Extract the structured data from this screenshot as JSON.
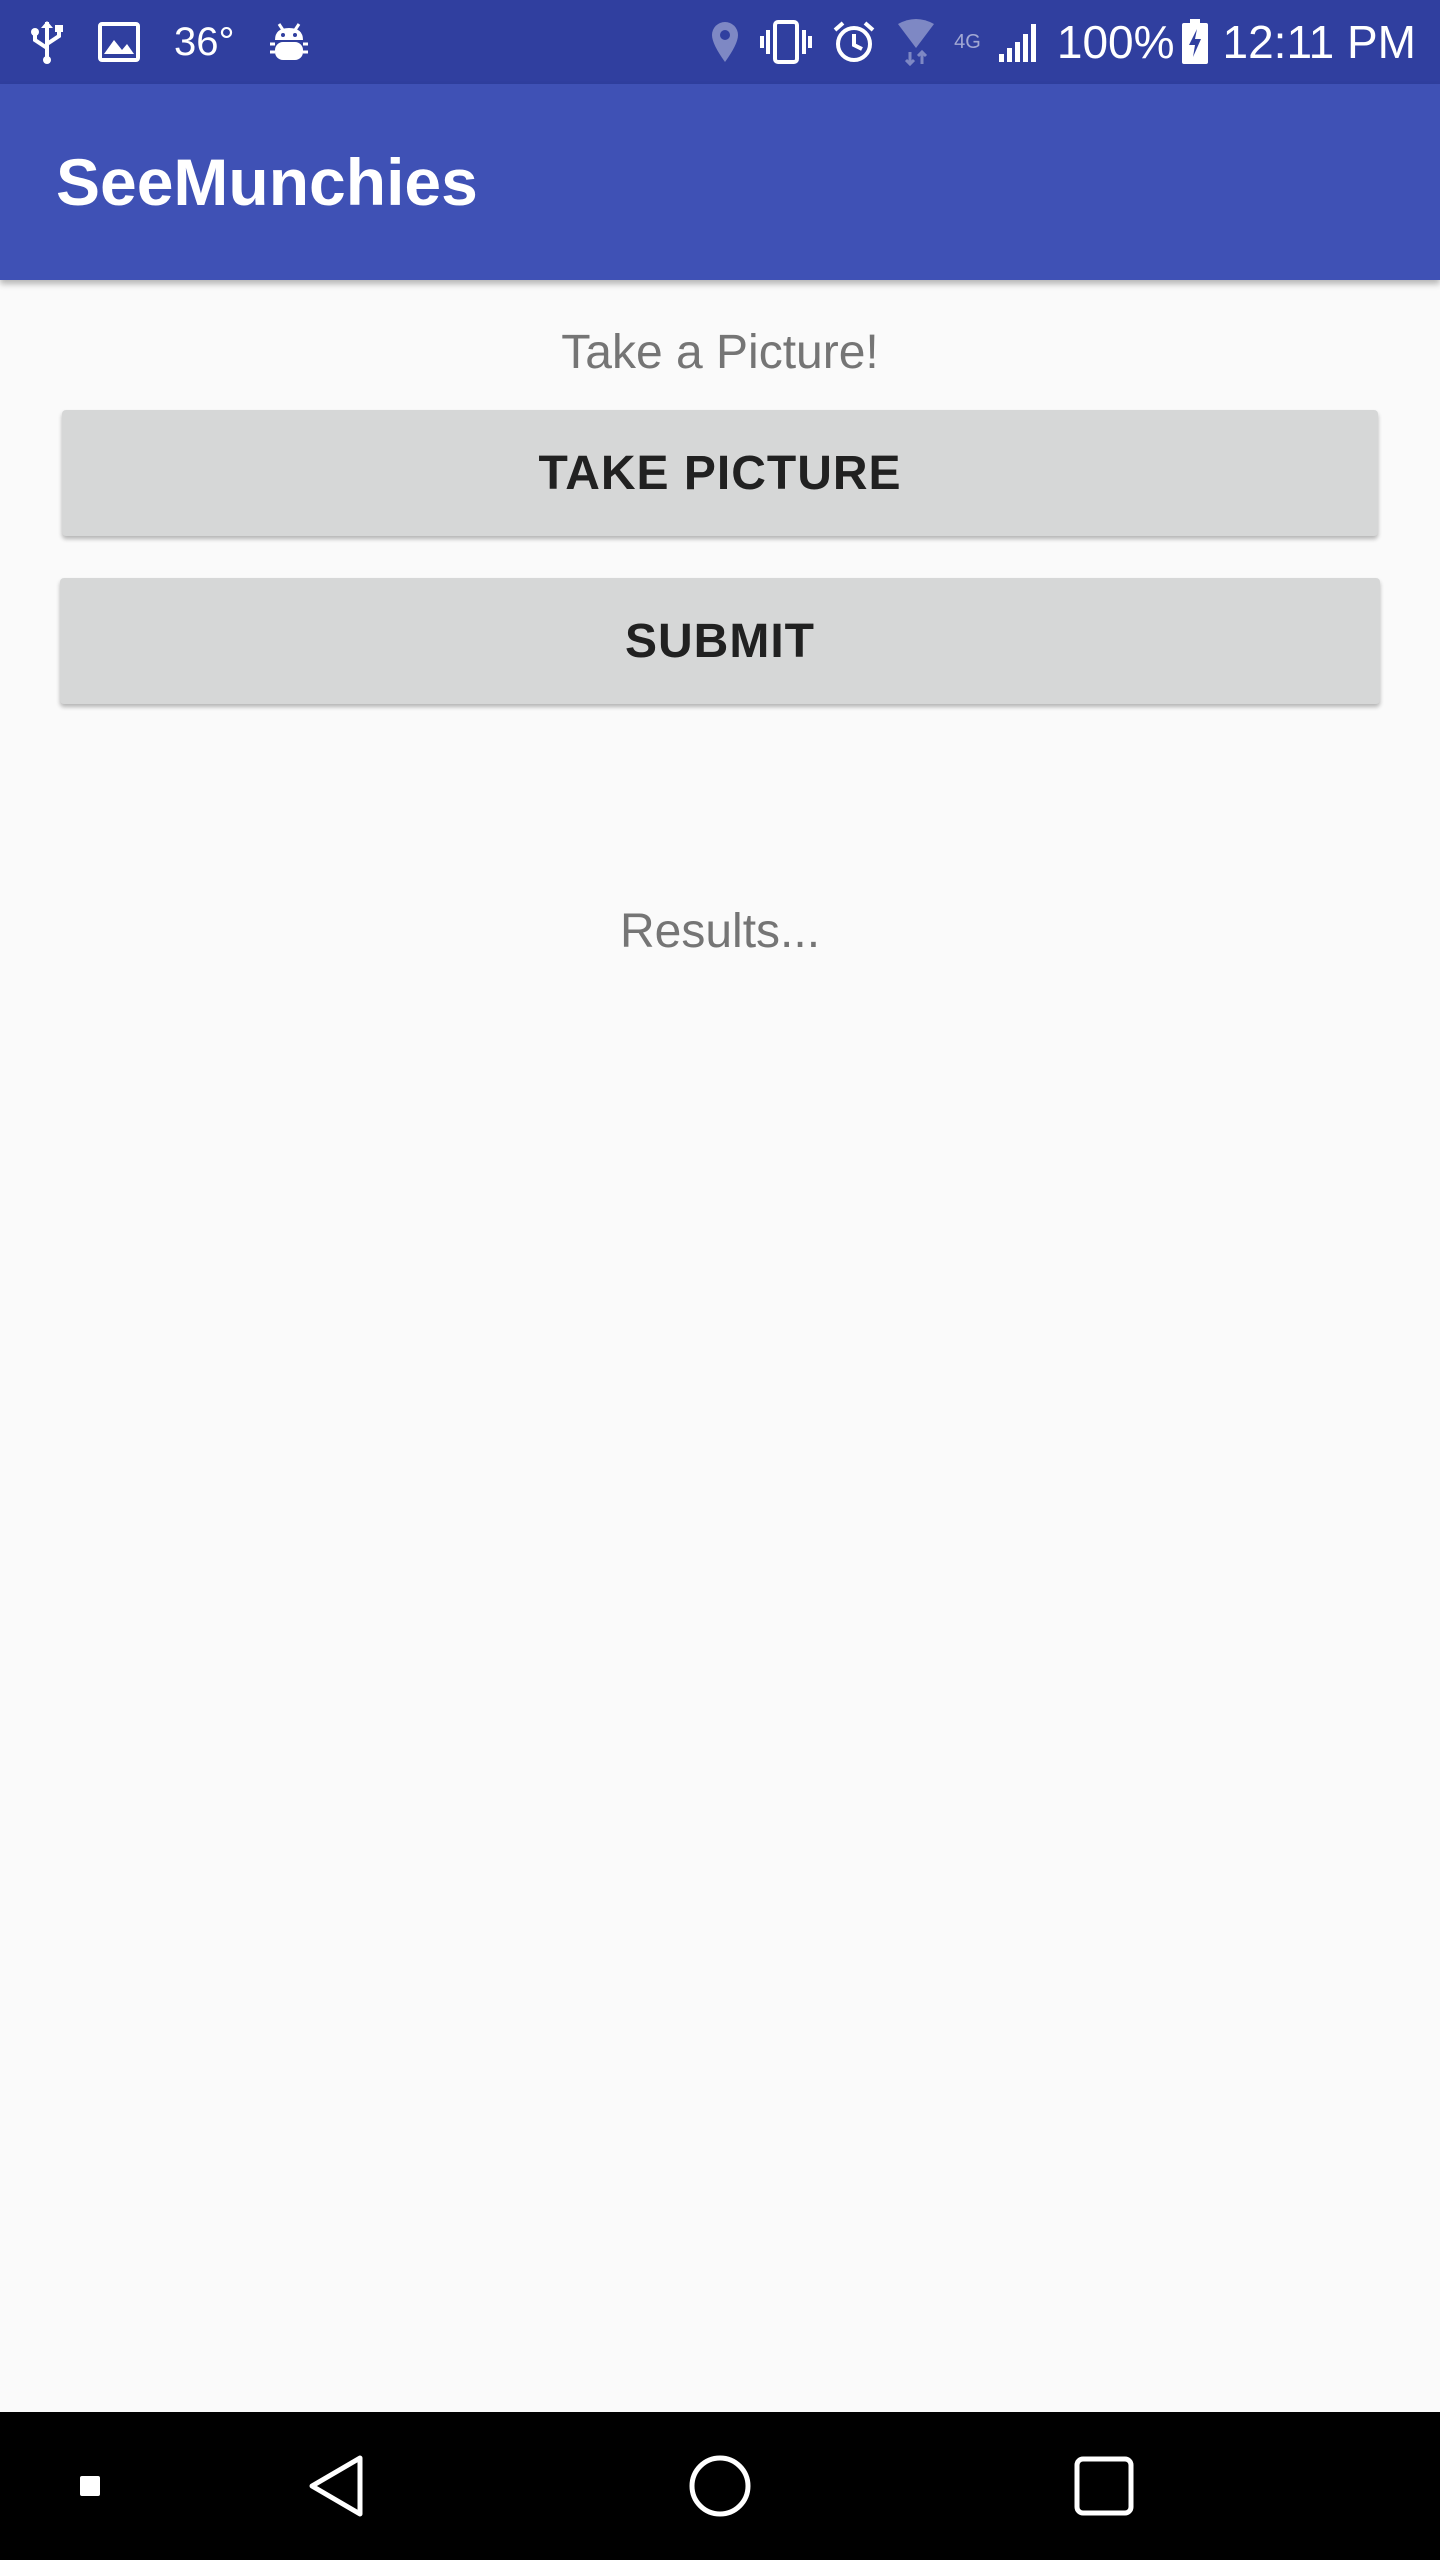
{
  "status_bar": {
    "left_icons": [
      "usb-icon",
      "image-icon",
      "android-debug-icon"
    ],
    "temperature": "36°",
    "right_icons": [
      "location-icon",
      "vibrate-icon",
      "alarm-icon",
      "wifi-icon",
      "lte-label",
      "signal-icon",
      "battery-charging-icon"
    ],
    "network_label": "4G",
    "battery": "100%",
    "time": "12:11 PM",
    "background_color": "#303f9f"
  },
  "app_bar": {
    "title": "SeeMunchies",
    "background_color": "#3f51b5"
  },
  "main": {
    "prompt": "Take a Picture!",
    "take_picture_label": "TAKE PICTURE",
    "submit_label": "SUBMIT",
    "results_text": "Results..."
  },
  "nav_bar": {
    "icons": [
      "dot-icon",
      "back-icon",
      "home-icon",
      "recents-icon"
    ]
  }
}
